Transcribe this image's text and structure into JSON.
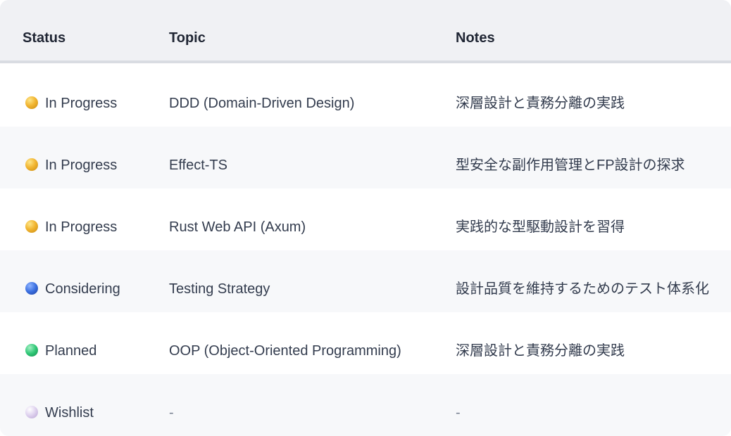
{
  "table": {
    "headers": {
      "status": "Status",
      "topic": "Topic",
      "notes": "Notes"
    },
    "rows": [
      {
        "status": "In Progress",
        "status_icon": "status-dot-in-progress-icon",
        "topic": "DDD (Domain-Driven Design)",
        "notes": "深層設計と責務分離の実践"
      },
      {
        "status": "In Progress",
        "status_icon": "status-dot-in-progress-icon",
        "topic": "Effect-TS",
        "notes": "型安全な副作用管理とFP設計の探求"
      },
      {
        "status": "In Progress",
        "status_icon": "status-dot-in-progress-icon",
        "topic": "Rust Web API (Axum)",
        "notes": "実践的な型駆動設計を習得"
      },
      {
        "status": "Considering",
        "status_icon": "status-dot-considering-icon",
        "topic": "Testing Strategy",
        "notes": "設計品質を維持するためのテスト体系化"
      },
      {
        "status": "Planned",
        "status_icon": "status-dot-planned-icon",
        "topic": "OOP (Object-Oriented Programming)",
        "notes": "深層設計と責務分離の実践"
      },
      {
        "status": "Wishlist",
        "status_icon": "status-dot-wishlist-icon",
        "topic": "-",
        "notes": "-"
      }
    ]
  },
  "colors": {
    "in_progress": "#f2b632",
    "considering": "#3a6fe0",
    "planned": "#2fc776",
    "wishlist": "#e1d5f0",
    "header_bg": "#f0f1f4",
    "alt_row_bg": "#f7f8fa"
  }
}
